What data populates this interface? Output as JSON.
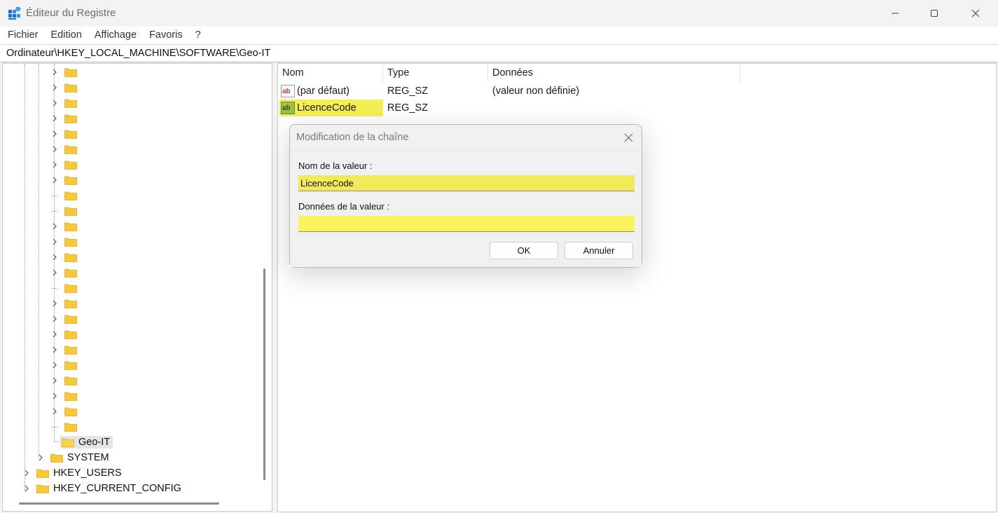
{
  "window": {
    "title": "Éditeur du Registre",
    "controls": [
      "minimize",
      "maximize",
      "close"
    ]
  },
  "menu": [
    "Fichier",
    "Edition",
    "Affichage",
    "Favoris",
    "?"
  ],
  "address": "Ordinateur\\HKEY_LOCAL_MACHINE\\SOFTWARE\\Geo-IT",
  "tree": {
    "unnamed_folder_count": 24,
    "selected": "Geo-IT",
    "nodes": [
      "Geo-IT",
      "SYSTEM",
      "HKEY_USERS",
      "HKEY_CURRENT_CONFIG"
    ]
  },
  "list": {
    "columns": [
      "Nom",
      "Type",
      "Données"
    ],
    "rows": [
      {
        "name": "(par défaut)",
        "type": "REG_SZ",
        "data": "(valeur non définie)"
      },
      {
        "name": "LicenceCode",
        "type": "REG_SZ",
        "data": ""
      }
    ]
  },
  "dialog": {
    "title": "Modification de la chaîne",
    "name_label": "Nom de la valeur :",
    "name_value": "LicenceCode",
    "data_label": "Données de la valeur :",
    "data_value": "",
    "ok_label": "OK",
    "cancel_label": "Annuler"
  },
  "colors": {
    "highlight": "#f5ef55",
    "folder": "#f8c83c",
    "background": "#f3f3f3"
  }
}
